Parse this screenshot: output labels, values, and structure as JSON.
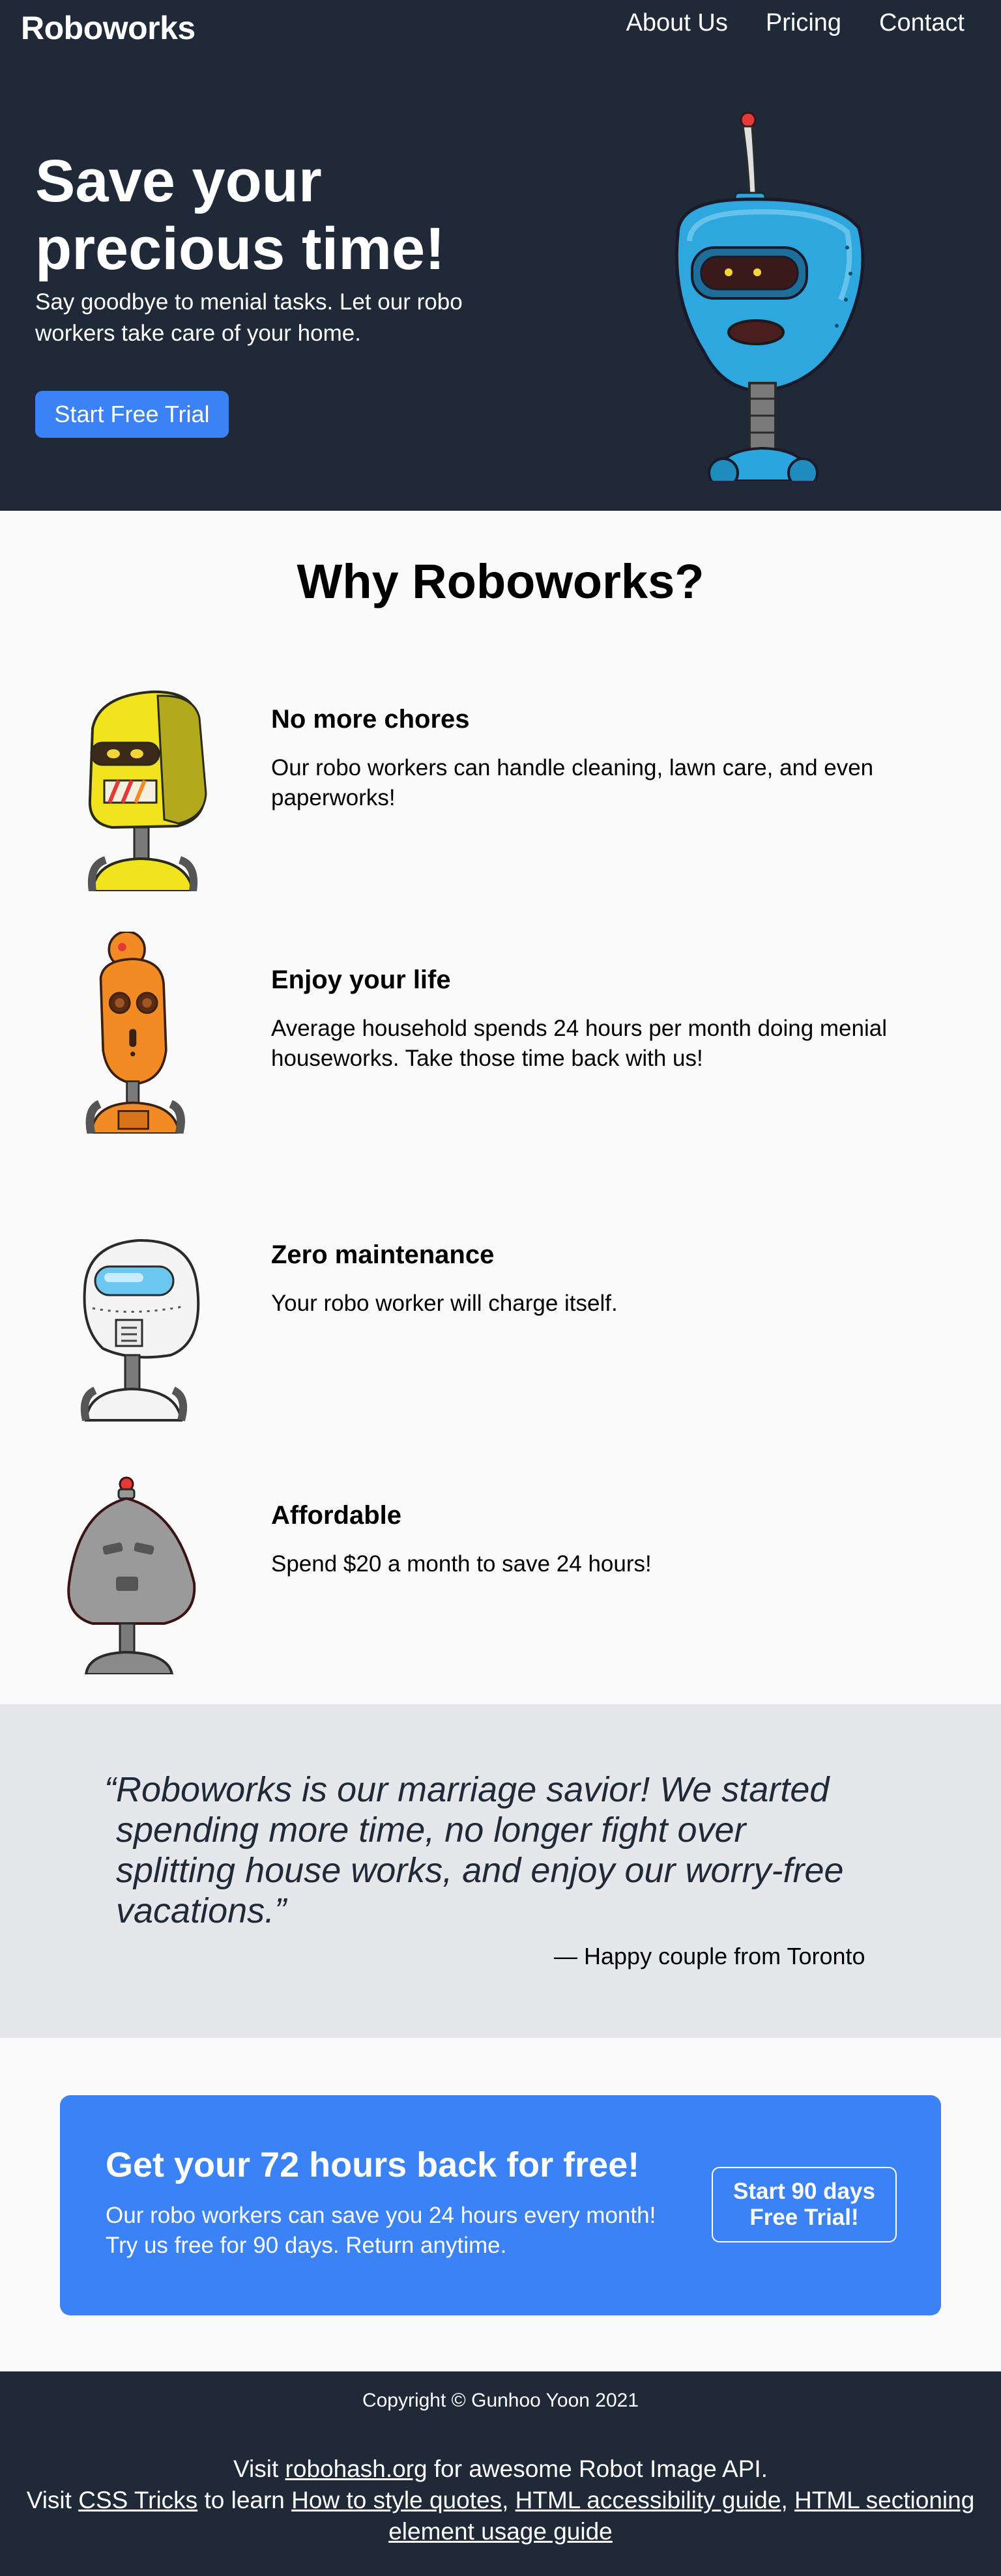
{
  "header": {
    "logo": "Roboworks",
    "nav": [
      "About Us",
      "Pricing",
      "Contact"
    ]
  },
  "hero": {
    "title_line1": "Save your",
    "title_line2": "precious time!",
    "subtitle": "Say goodbye to menial tasks. Let our robo workers take care of your home.",
    "cta_label": "Start Free Trial"
  },
  "features_section": {
    "title": "Why Roboworks?",
    "items": [
      {
        "title": "No more chores",
        "text": "Our robo workers can handle cleaning, lawn care, and even paperworks!"
      },
      {
        "title": "Enjoy your life",
        "text": "Average household spends 24 hours per month doing menial houseworks. Take those time back with us!"
      },
      {
        "title": "Zero maintenance",
        "text": "Your robo worker will charge itself."
      },
      {
        "title": "Affordable",
        "text": "Spend $20 a month to save 24 hours!"
      }
    ]
  },
  "testimonial": {
    "open_quote": "“",
    "quote": "Roboworks is our marriage savior! We started spending more time, no longer fight over splitting house works, and enjoy our worry-free vacations.”",
    "author": "— Happy couple from Toronto"
  },
  "cta": {
    "title": "Get your 72 hours back for free!",
    "text": "Our robo workers can save you 24 hours every month! Try us free for 90 days. Return anytime.",
    "button_label": "Start 90 days Free Trial!"
  },
  "footer": {
    "copyright": "Copyright © Gunhoo Yoon 2021",
    "visit1_prefix": "Visit ",
    "robohash_link": "robohash.org",
    "visit1_suffix": " for awesome Robot Image API.",
    "visit2_prefix": "Visit ",
    "css_tricks_link": "CSS Tricks",
    "visit2_mid": " to learn ",
    "quotes_link": "How to style quotes",
    "sep1": ", ",
    "a11y_link": "HTML accessibility guide",
    "sep2": ", ",
    "sectioning_link": "HTML sectioning element usage guide"
  },
  "colors": {
    "dark_bg": "#1f2937",
    "accent": "#3b82f6",
    "page_bg": "#fafafa",
    "quote_bg": "#e5e7eb"
  }
}
